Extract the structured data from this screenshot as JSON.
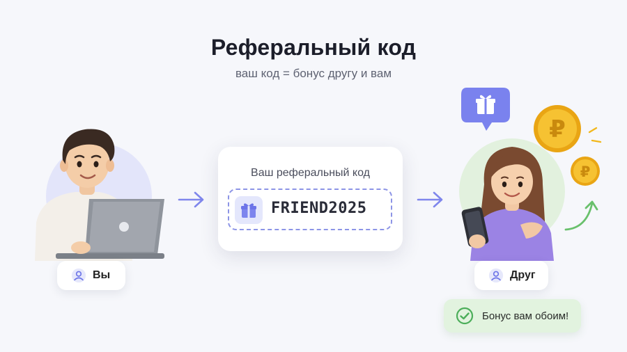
{
  "header": {
    "title": "Реферальный код",
    "subtitle": "ваш код = бонус другу и вам"
  },
  "left": {
    "label": "Вы",
    "icon": "user-icon"
  },
  "code_card": {
    "label": "Ваш реферальный код",
    "code": "FRIEND2025",
    "icon": "gift-icon"
  },
  "right": {
    "label": "Друг",
    "icon": "user-icon"
  },
  "bonus": {
    "text": "Бонус вам обоим!",
    "icon": "check-circle-icon"
  },
  "coins": {
    "symbol": "₽"
  },
  "colors": {
    "accent": "#6c74e8",
    "arrow": "#7f86ec",
    "bonus_bg": "#e2f3df",
    "check": "#4cae5a",
    "coin": "#f2b81c",
    "chat_bubble": "#7a82ee"
  }
}
